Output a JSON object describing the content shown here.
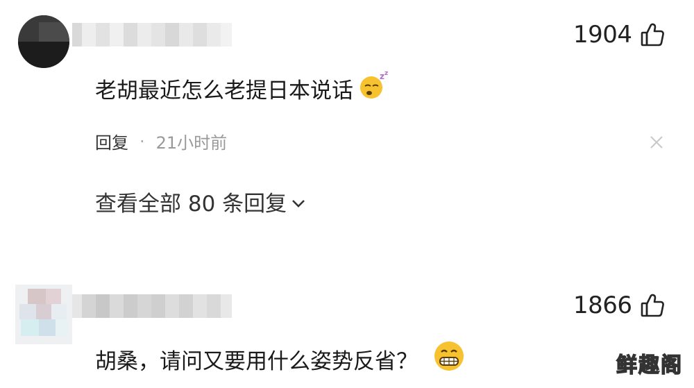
{
  "comments": [
    {
      "likes": "1904",
      "text": "老胡最近怎么老提日本说话",
      "emoji_icon": "sleepy-face-emoji",
      "reply_label": "回复",
      "separator": "·",
      "time": "21小时前",
      "view_all": "查看全部 80 条回复"
    },
    {
      "likes": "1866",
      "text": "胡桑，请问又要用什么姿势反省？",
      "emoji_icon": "grimacing-face-emoji"
    }
  ],
  "watermark": "鲜趣阁",
  "colors": {
    "text_primary": "#1a1a1a",
    "text_secondary": "#999999",
    "emoji_yellow": "#f7c230"
  }
}
